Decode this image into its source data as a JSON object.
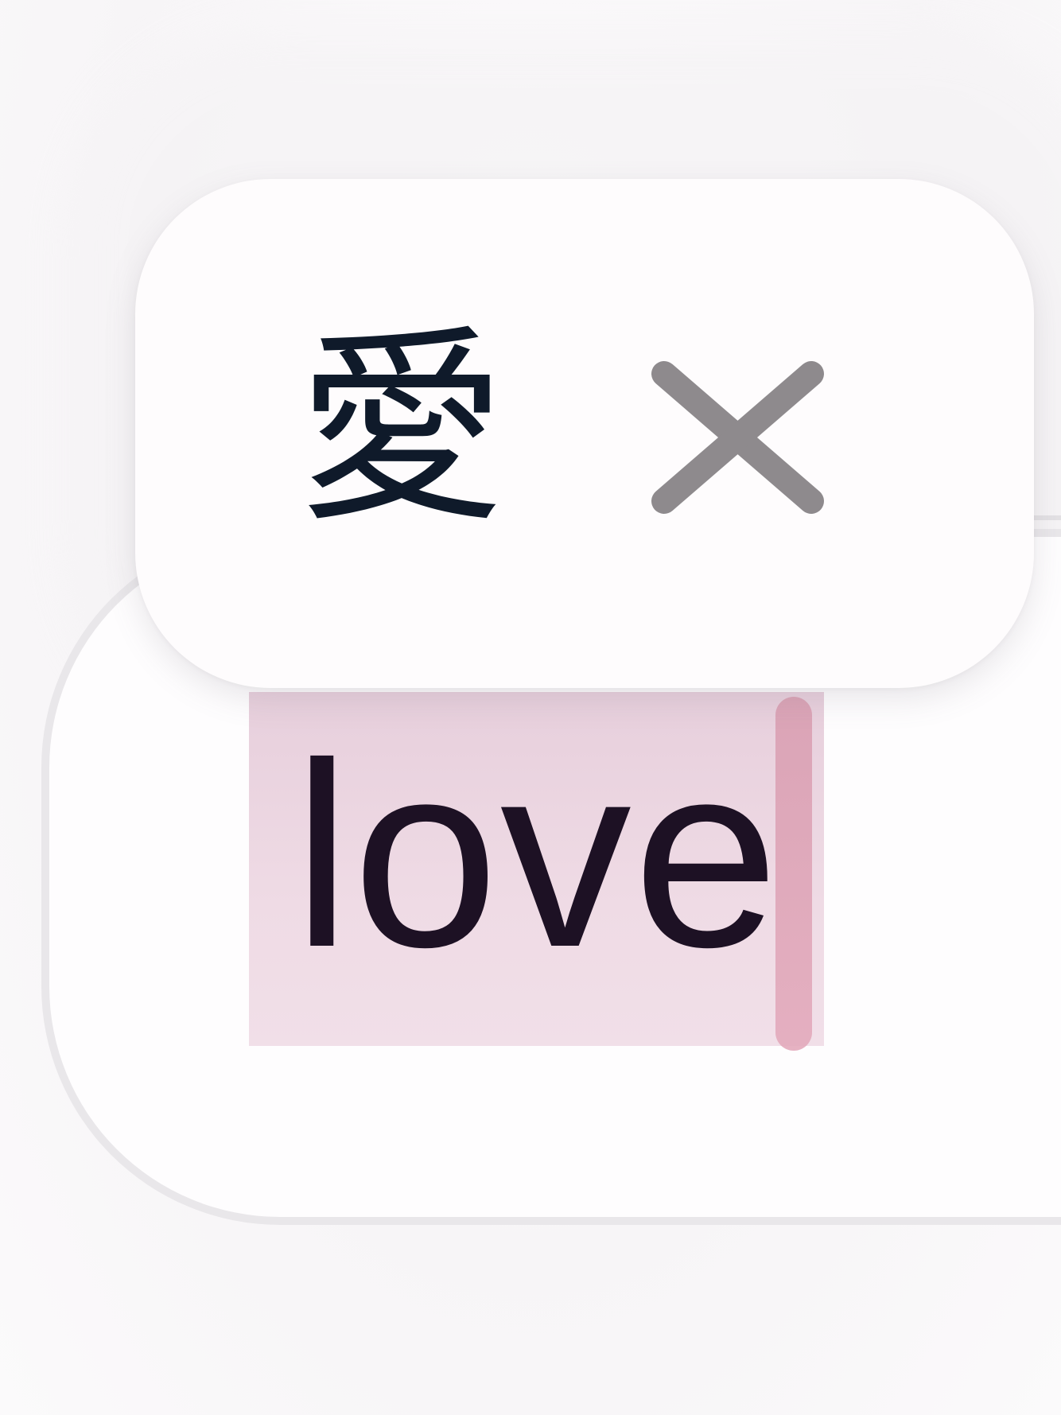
{
  "candidate": {
    "text": "愛",
    "close_icon": "close-icon"
  },
  "input": {
    "value": "love",
    "selection_color": "#ecd5e1",
    "cursor_color": "#e0a6b8"
  },
  "colors": {
    "text_primary": "#0f1a2a",
    "icon_gray": "#8e8a8d",
    "background": "#fcfbfc"
  }
}
